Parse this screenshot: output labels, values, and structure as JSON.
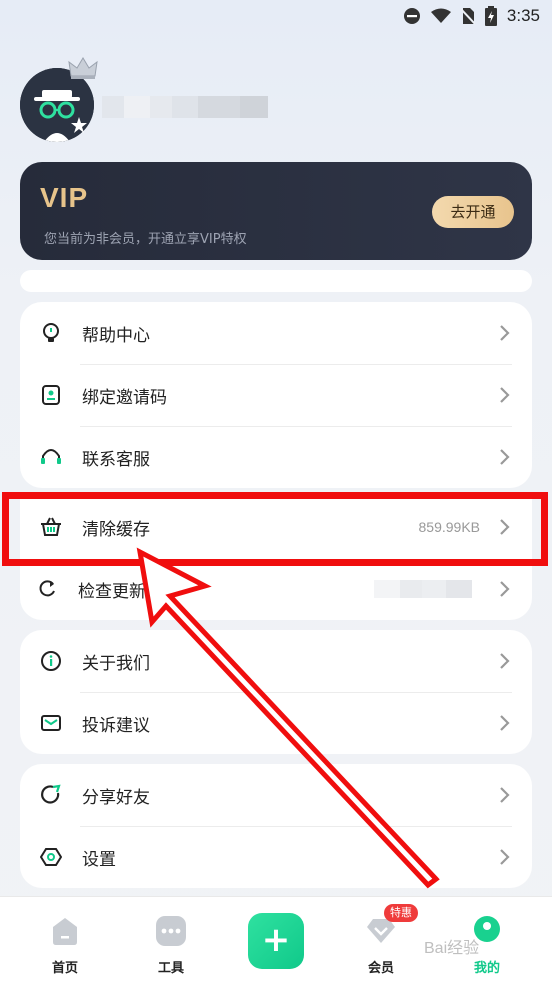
{
  "status_bar": {
    "time": "3:35"
  },
  "vip": {
    "title": "VIP",
    "subtitle": "您当前为非会员，开通立享VIP特权",
    "button": "去开通"
  },
  "menu_group_1": [
    {
      "label": "帮助中心",
      "icon": "bulb-icon"
    },
    {
      "label": "绑定邀请码",
      "icon": "badge-icon"
    },
    {
      "label": "联系客服",
      "icon": "headset-icon"
    }
  ],
  "cache_row": {
    "label": "清除缓存",
    "value": "859.99KB",
    "icon": "basket-icon"
  },
  "update_row": {
    "label": "检查更新",
    "icon": "refresh-icon"
  },
  "menu_group_2": [
    {
      "label": "关于我们",
      "icon": "info-icon"
    },
    {
      "label": "投诉建议",
      "icon": "mail-icon"
    }
  ],
  "menu_group_3": [
    {
      "label": "分享好友",
      "icon": "share-icon"
    },
    {
      "label": "设置",
      "icon": "gear-icon"
    }
  ],
  "tabbar": {
    "home": "首页",
    "tools": "工具",
    "add": "+",
    "member": "会员",
    "member_badge": "特惠",
    "mine": "我的"
  },
  "watermark": "Bai经验",
  "colors": {
    "accent": "#10c98a",
    "highlight": "#f00e0e",
    "vip_gold": "#e7c48b"
  }
}
